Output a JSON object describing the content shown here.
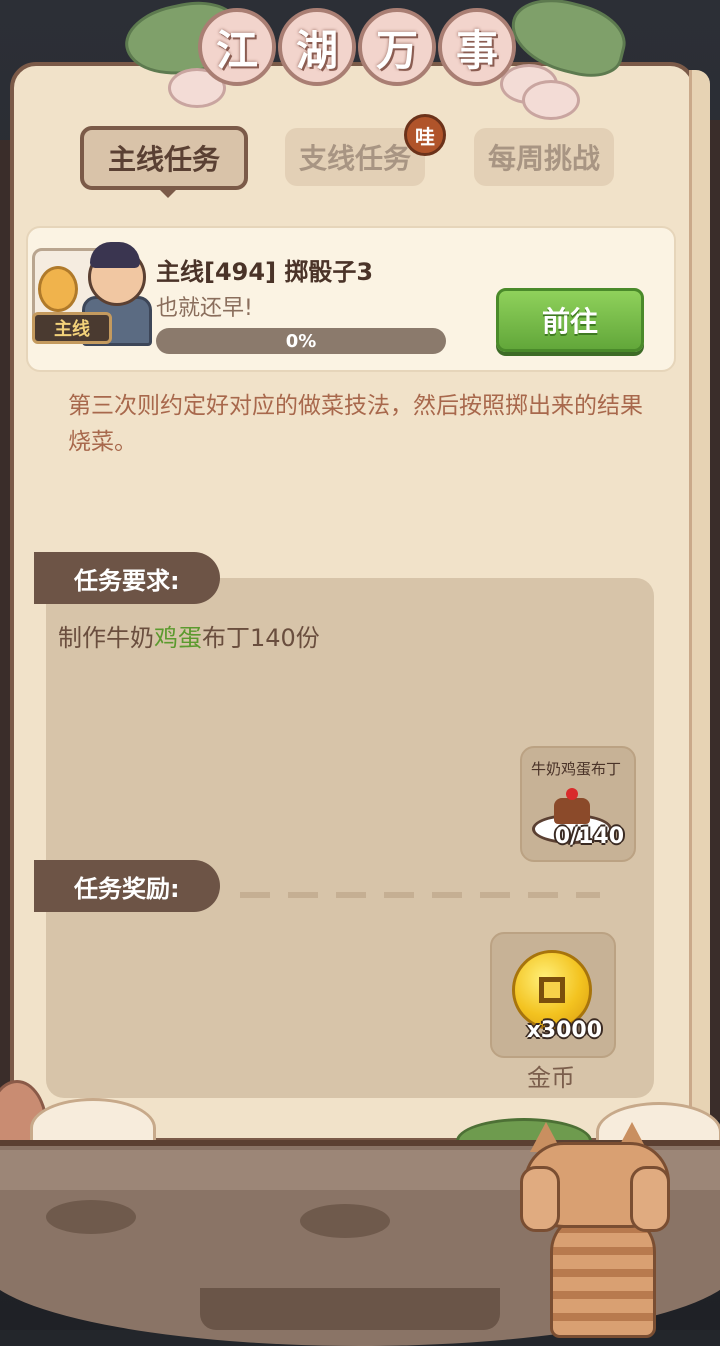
{
  "title": {
    "chars": [
      "江",
      "湖",
      "万",
      "事"
    ]
  },
  "tabs": [
    {
      "label": "主线任务",
      "active": true
    },
    {
      "label": "支线任务",
      "active": false,
      "badge": "哇"
    },
    {
      "label": "每周挑战",
      "active": false
    }
  ],
  "quest": {
    "tag": "主线",
    "title": "主线[494] 掷骰子3",
    "subtitle": "也就还早!",
    "progress": {
      "value": 0,
      "label": "0%"
    },
    "go_button": "前往",
    "description": "第三次则约定好对应的做菜技法，然后按照掷出来的结果烧菜。"
  },
  "requirement": {
    "label": "任务要求:",
    "text_before": "制作牛奶",
    "text_highlight": "鸡蛋",
    "text_after": "布丁140份",
    "item": {
      "name": "牛奶鸡蛋布丁",
      "count": "0/140",
      "icon": "pudding-icon"
    }
  },
  "reward": {
    "label": "任务奖励:",
    "item": {
      "name": "金币",
      "count": "x3000",
      "icon": "gold-coin-icon"
    }
  },
  "colors": {
    "accent_green": "#62a73a",
    "highlight_green": "#5b9a2e",
    "desc_text": "#a8684c",
    "panel_brown": "#6d5446"
  }
}
